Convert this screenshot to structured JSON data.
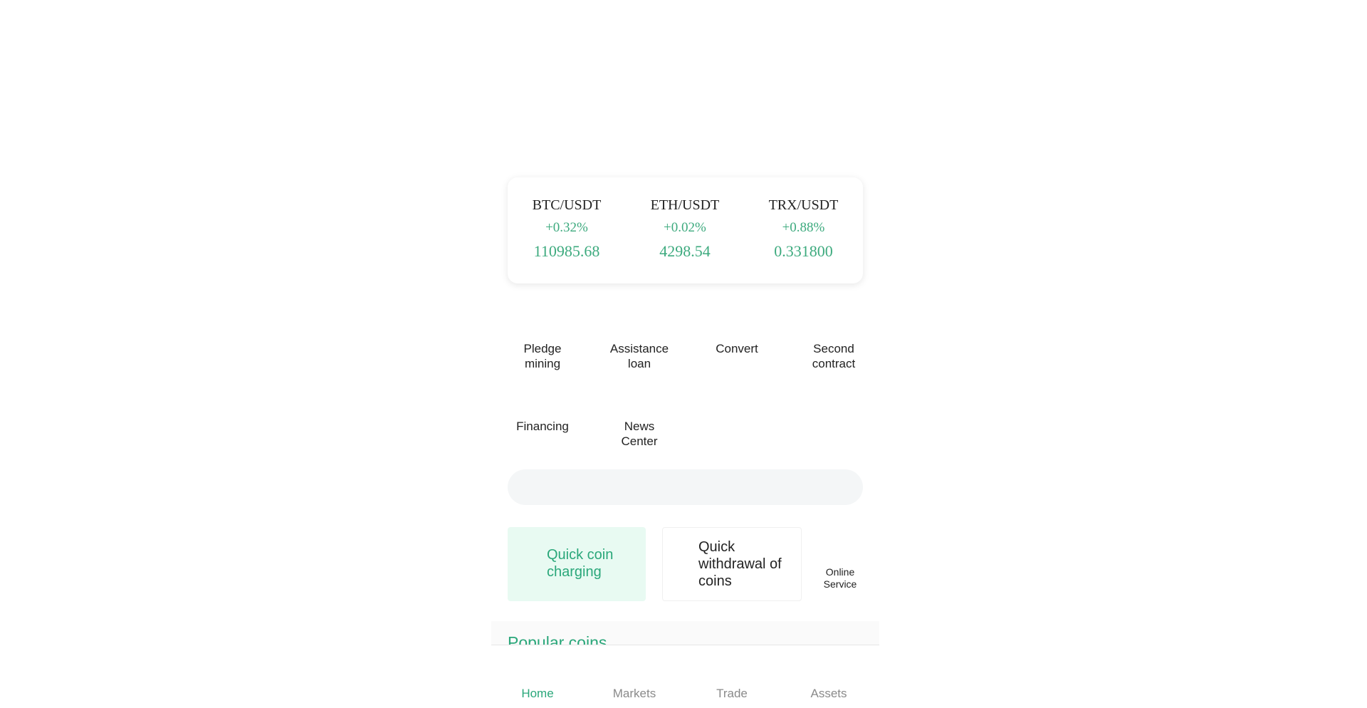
{
  "tickers": [
    {
      "pair": "BTC/USDT",
      "change": "+0.32%",
      "price": "110985.68"
    },
    {
      "pair": "ETH/USDT",
      "change": "+0.02%",
      "price": "4298.54"
    },
    {
      "pair": "TRX/USDT",
      "change": "+0.88%",
      "price": "0.331800"
    }
  ],
  "shortcuts": [
    {
      "label": "Pledge\nmining"
    },
    {
      "label": "Assistance\nloan"
    },
    {
      "label": "Convert"
    },
    {
      "label": "Second\ncontract"
    },
    {
      "label": "Financing"
    },
    {
      "label": "News\nCenter"
    }
  ],
  "quick_actions": {
    "charge_label": "Quick coin charging",
    "withdraw_label": "Quick withdrawal of coins",
    "service_label": "Online Service"
  },
  "popular": {
    "title": "Popular coins"
  },
  "bottom_nav": [
    {
      "label": "Home",
      "active": true
    },
    {
      "label": "Markets",
      "active": false
    },
    {
      "label": "Trade",
      "active": false
    },
    {
      "label": "Assets",
      "active": false
    }
  ],
  "colors": {
    "accent": "#2aa77a",
    "positive": "#3daa7e",
    "charge_bg": "#e8faf2",
    "search_bg": "#f4f6f7"
  }
}
